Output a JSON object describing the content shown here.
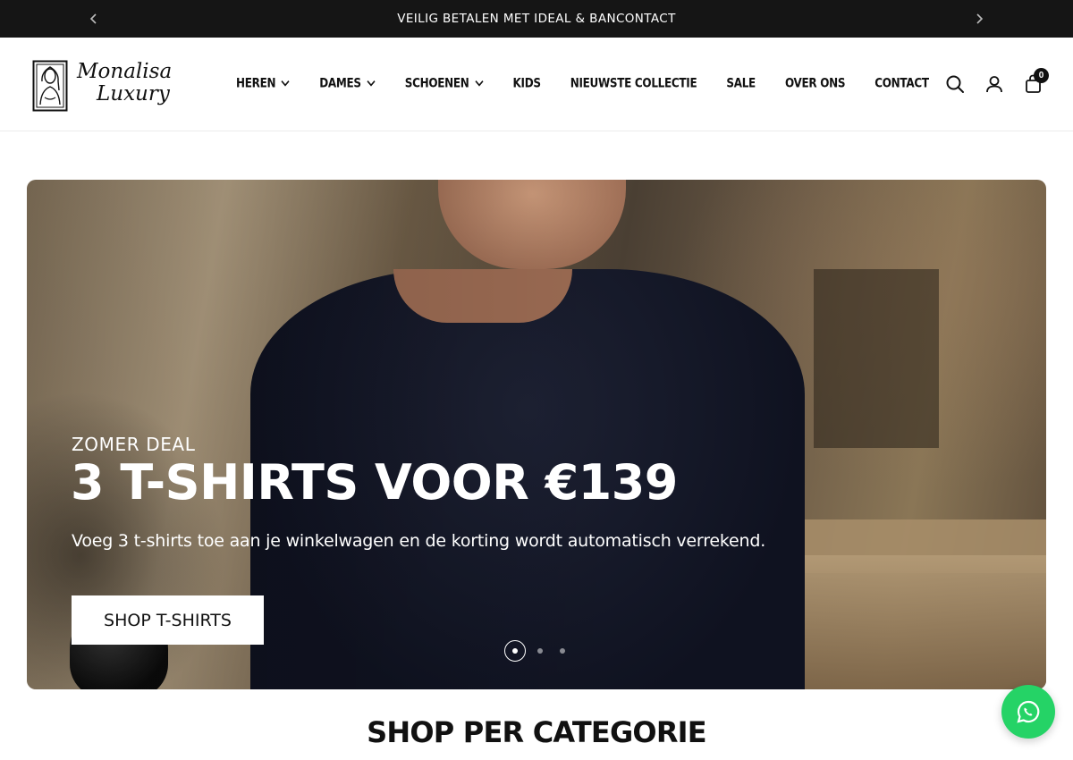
{
  "announcement": {
    "message": "VEILIG BETALEN MET IDEAL & BANCONTACT",
    "prev_icon": "chevron-left-icon",
    "next_icon": "chevron-right-icon"
  },
  "brand": {
    "name_line1": "Monalisa",
    "name_line2": "Luxury"
  },
  "nav": {
    "items": [
      {
        "label": "HEREN",
        "has_dropdown": true
      },
      {
        "label": "DAMES",
        "has_dropdown": true
      },
      {
        "label": "SCHOENEN",
        "has_dropdown": true
      },
      {
        "label": "KIDS",
        "has_dropdown": false
      },
      {
        "label": "NIEUWSTE COLLECTIE",
        "has_dropdown": false
      },
      {
        "label": "SALE",
        "has_dropdown": false
      },
      {
        "label": "OVER ONS",
        "has_dropdown": false
      },
      {
        "label": "CONTACT",
        "has_dropdown": false
      }
    ]
  },
  "header_icons": {
    "search": "search-icon",
    "account": "user-icon",
    "cart": "shopping-bag-icon",
    "cart_count": "0"
  },
  "hero": {
    "eyebrow": "ZOMER DEAL",
    "headline": "3 T-SHIRTS VOOR €139",
    "subtext": "Voeg 3 t-shirts toe aan je winkelwagen en de korting wordt automatisch verrekend.",
    "cta_label": "SHOP T-SHIRTS",
    "slides_total": 3,
    "active_slide": 1
  },
  "section": {
    "title": "SHOP PER CATEGORIE"
  },
  "floating": {
    "whatsapp_icon": "whatsapp-icon",
    "color": "#25d366"
  }
}
